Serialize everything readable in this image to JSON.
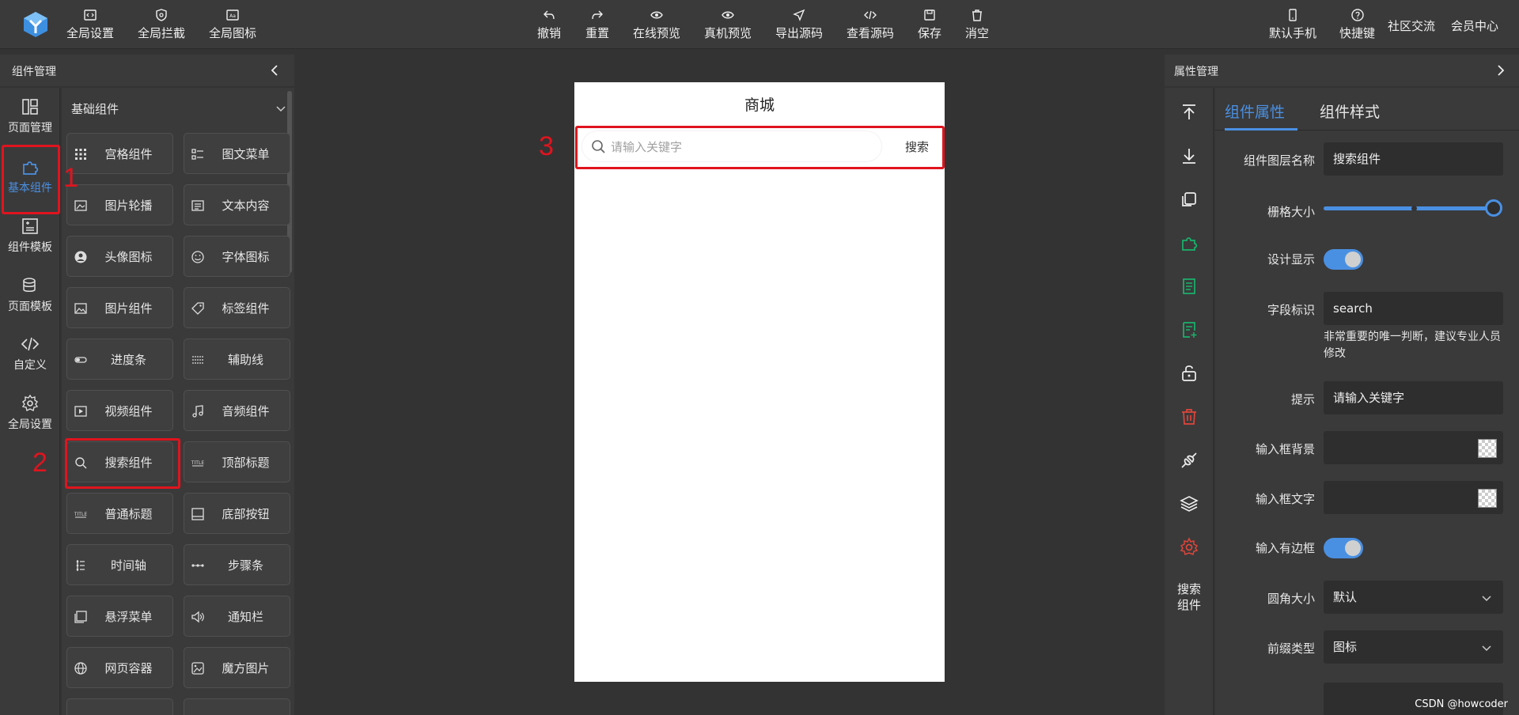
{
  "topbar": {
    "left_buttons": [
      {
        "label": "全局设置",
        "icon": "code-icon"
      },
      {
        "label": "全局拦截",
        "icon": "shield-icon"
      },
      {
        "label": "全局图标",
        "icon": "icon-set-icon"
      }
    ],
    "center_buttons": [
      {
        "label": "撤销",
        "icon": "undo-icon"
      },
      {
        "label": "重置",
        "icon": "redo-icon"
      },
      {
        "label": "在线预览",
        "icon": "eye-icon"
      },
      {
        "label": "真机预览",
        "icon": "eye-icon"
      },
      {
        "label": "导出源码",
        "icon": "send-icon"
      },
      {
        "label": "查看源码",
        "icon": "code-icon"
      },
      {
        "label": "保存",
        "icon": "save-icon"
      },
      {
        "label": "消空",
        "icon": "trash-icon"
      }
    ],
    "right_buttons": [
      {
        "label": "默认手机",
        "icon": "phone-icon"
      },
      {
        "label": "快捷键",
        "icon": "help-icon"
      }
    ],
    "links": [
      "社区交流",
      "会员中心"
    ]
  },
  "left_panel": {
    "title": "组件管理",
    "nav": [
      {
        "label": "页面管理",
        "icon": "layout-icon"
      },
      {
        "label": "基本组件",
        "icon": "puzzle-icon",
        "active": true
      },
      {
        "label": "组件模板",
        "icon": "template-icon"
      },
      {
        "label": "页面模板",
        "icon": "database-icon"
      },
      {
        "label": "自定义",
        "icon": "code-icon"
      },
      {
        "label": "全局设置",
        "icon": "gear-icon"
      }
    ],
    "category": "基础组件",
    "components": [
      {
        "label": "宫格组件",
        "icon": "grid-icon"
      },
      {
        "label": "图文菜单",
        "icon": "list-icon"
      },
      {
        "label": "图片轮播",
        "icon": "carousel-icon"
      },
      {
        "label": "文本内容",
        "icon": "text-icon"
      },
      {
        "label": "头像图标",
        "icon": "avatar-icon"
      },
      {
        "label": "字体图标",
        "icon": "smile-icon"
      },
      {
        "label": "图片组件",
        "icon": "image-icon"
      },
      {
        "label": "标签组件",
        "icon": "tag-icon"
      },
      {
        "label": "进度条",
        "icon": "progress-icon"
      },
      {
        "label": "辅助线",
        "icon": "lines-icon"
      },
      {
        "label": "视频组件",
        "icon": "video-icon"
      },
      {
        "label": "音频组件",
        "icon": "music-icon"
      },
      {
        "label": "搜索组件",
        "icon": "search-icon"
      },
      {
        "label": "顶部标题",
        "icon": "title-icon"
      },
      {
        "label": "普通标题",
        "icon": "title-icon"
      },
      {
        "label": "底部按钮",
        "icon": "bottom-bar-icon"
      },
      {
        "label": "时间轴",
        "icon": "timeline-icon"
      },
      {
        "label": "步骤条",
        "icon": "steps-icon"
      },
      {
        "label": "悬浮菜单",
        "icon": "float-icon"
      },
      {
        "label": "通知栏",
        "icon": "speaker-icon"
      },
      {
        "label": "网页容器",
        "icon": "globe-icon"
      },
      {
        "label": "魔方图片",
        "icon": "cube-image-icon"
      }
    ]
  },
  "annotations": [
    "1",
    "2",
    "3"
  ],
  "phone": {
    "title": "商城",
    "search_placeholder": "请输入关键字",
    "search_button": "搜索"
  },
  "right_panel": {
    "title": "属性管理",
    "tools": [
      {
        "icon": "move-top-icon"
      },
      {
        "icon": "move-down-icon"
      },
      {
        "icon": "copy-icon"
      },
      {
        "icon": "puzzle-icon"
      },
      {
        "icon": "document-icon"
      },
      {
        "icon": "document-add-icon"
      },
      {
        "icon": "unlock-icon"
      },
      {
        "icon": "delete-icon"
      },
      {
        "icon": "plug-icon"
      },
      {
        "icon": "layers-icon"
      },
      {
        "icon": "gear-icon"
      }
    ],
    "current_component": "搜索\n组件",
    "tabs": [
      "组件属性",
      "组件样式"
    ],
    "active_tab": 0,
    "props": {
      "layer_name_label": "组件图层名称",
      "layer_name_value": "搜索组件",
      "grid_size_label": "栅格大小",
      "grid_size_value": 1.0,
      "design_show_label": "设计显示",
      "design_show_on": true,
      "field_id_label": "字段标识",
      "field_id_value": "search",
      "field_id_hint": "非常重要的唯一判断，建议专业人员修改",
      "hint_label": "提示",
      "hint_value": "请输入关键字",
      "input_bg_label": "输入框背景",
      "input_text_label": "输入框文字",
      "has_border_label": "输入有边框",
      "has_border_on": true,
      "radius_label": "圆角大小",
      "radius_value": "默认",
      "prefix_label": "前缀类型",
      "prefix_value": "图标"
    },
    "colors": {
      "accent": "#4a90e2",
      "annotation_red": "#e0141e"
    }
  },
  "watermark": "CSDN @howcoder"
}
